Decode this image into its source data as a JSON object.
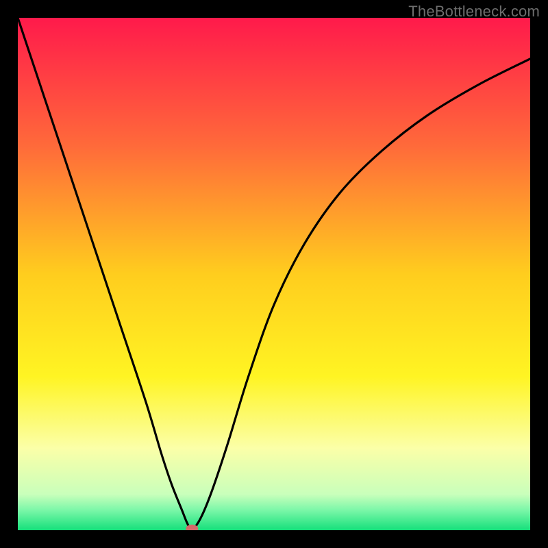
{
  "watermark": "TheBottleneck.com",
  "chart_data": {
    "type": "line",
    "title": "",
    "xlabel": "",
    "ylabel": "",
    "xlim": [
      0,
      100
    ],
    "ylim": [
      0,
      100
    ],
    "grid": false,
    "legend": false,
    "background_gradient": {
      "stops": [
        {
          "pos": 0.0,
          "color": "#ff1a4b"
        },
        {
          "pos": 0.25,
          "color": "#ff6a3a"
        },
        {
          "pos": 0.5,
          "color": "#ffcd1e"
        },
        {
          "pos": 0.7,
          "color": "#fff423"
        },
        {
          "pos": 0.84,
          "color": "#fbffa8"
        },
        {
          "pos": 0.93,
          "color": "#c9ffbb"
        },
        {
          "pos": 0.96,
          "color": "#7df7a9"
        },
        {
          "pos": 1.0,
          "color": "#15e07b"
        }
      ]
    },
    "series": [
      {
        "name": "bottleneck-curve",
        "x": [
          0,
          5,
          10,
          15,
          20,
          25,
          28,
          30,
          32,
          33,
          33.7,
          34.5,
          36,
          38,
          41,
          45,
          50,
          56,
          63,
          71,
          80,
          90,
          100
        ],
        "y": [
          100,
          85,
          70,
          55,
          40,
          25,
          15,
          9,
          4,
          1.5,
          0.3,
          0.5,
          3,
          8,
          17,
          30,
          44,
          56,
          66,
          74,
          81,
          87,
          92
        ]
      }
    ],
    "marker": {
      "name": "minimum-point",
      "x": 34,
      "y": 0.3,
      "color": "#d36a6a"
    }
  }
}
